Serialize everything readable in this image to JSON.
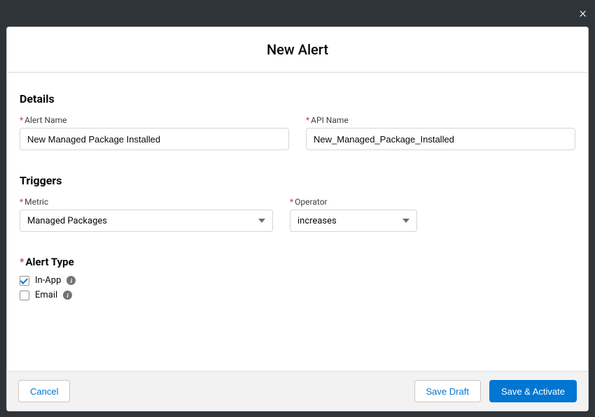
{
  "close_label": "×",
  "title": "New Alert",
  "details": {
    "heading": "Details",
    "alert_name": {
      "label": "Alert Name",
      "value": "New Managed Package Installed"
    },
    "api_name": {
      "label": "API Name",
      "value": "New_Managed_Package_Installed"
    }
  },
  "triggers": {
    "heading": "Triggers",
    "metric": {
      "label": "Metric",
      "value": "Managed Packages"
    },
    "operator": {
      "label": "Operator",
      "value": "increases"
    }
  },
  "alert_type": {
    "heading": "Alert Type",
    "in_app": {
      "label": "In-App",
      "checked": true
    },
    "email": {
      "label": "Email",
      "checked": false
    }
  },
  "footer": {
    "cancel": "Cancel",
    "save_draft": "Save Draft",
    "save_activate": "Save & Activate"
  }
}
